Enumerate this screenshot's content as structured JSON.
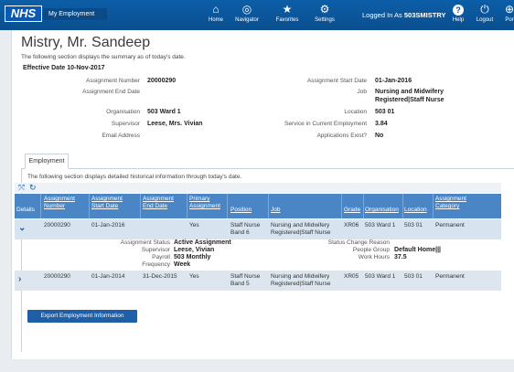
{
  "header": {
    "logo_text": "NHS",
    "app_name": "My Employment",
    "nav": [
      {
        "label": "Home",
        "icon": "home-icon",
        "glyph": "⌂"
      },
      {
        "label": "Navigator",
        "icon": "compass-icon",
        "glyph": "◎"
      },
      {
        "label": "Favorites",
        "icon": "star-icon",
        "glyph": "★"
      },
      {
        "label": "Settings",
        "icon": "gear-icon",
        "glyph": "⚙"
      }
    ],
    "logged_in_prefix": "Logged In As",
    "logged_in_user": "503SMISTRY",
    "right_nav": [
      {
        "label": "Help",
        "icon": "help-icon",
        "glyph": "?"
      },
      {
        "label": "Logout",
        "icon": "power-icon",
        "glyph": "⏻"
      },
      {
        "label": "Por",
        "icon": "globe-icon",
        "glyph": "⊕"
      }
    ]
  },
  "page": {
    "title": "Mistry, Mr. Sandeep",
    "subtitle": "The following section displays the summary as of today's date.",
    "effective_date": "Effective Date 10-Nov-2017"
  },
  "summary": {
    "left": [
      {
        "label": "Assignment Number",
        "value": "20000290"
      },
      {
        "label": "Assignment End Date",
        "value": ""
      },
      {
        "label": "Organisation",
        "value": "503 Ward 1"
      },
      {
        "label": "Supervisor",
        "value": "Leese, Mrs. Vivian"
      },
      {
        "label": "Email Address",
        "value": ""
      }
    ],
    "right": [
      {
        "label": "Assignment Start Date",
        "value": "01-Jan-2016"
      },
      {
        "label": "Job",
        "value": "Nursing and Midwifery",
        "value2": "Registered|Staff Nurse"
      },
      {
        "label": "Location",
        "value": "503 01"
      },
      {
        "label": "Service in Current Employment",
        "value": "3.84"
      },
      {
        "label": "Applications Exist?",
        "value": "No"
      }
    ]
  },
  "tabs": [
    {
      "label": "Employment"
    }
  ],
  "employment": {
    "description": "The following section displays detailed historical information through today's date.",
    "columns": [
      {
        "l1": "",
        "l2": "Details"
      },
      {
        "l1": "Assignment",
        "l2": "Number"
      },
      {
        "l1": "Assignment",
        "l2": "Start Date"
      },
      {
        "l1": "Assignment",
        "l2": "End Date"
      },
      {
        "l1": "Primary",
        "l2": "Assignment"
      },
      {
        "l1": "",
        "l2": "Position"
      },
      {
        "l1": "",
        "l2": "Job"
      },
      {
        "l1": "",
        "l2": "Grade"
      },
      {
        "l1": "",
        "l2": "Organisation"
      },
      {
        "l1": "",
        "l2": "Location"
      },
      {
        "l1": "Assignment",
        "l2": "Category"
      }
    ],
    "rows": [
      {
        "number": "20000290",
        "start": "01-Jan-2016",
        "end": "",
        "primary": "Yes",
        "position1": "Staff Nurse",
        "position2": "Band 6",
        "job1": "Nursing and Midwifery",
        "job2": "Registered|Staff Nurse",
        "grade": "XR06",
        "organisation": "503 Ward 1",
        "location": "503 01",
        "category": "Permanent"
      },
      {
        "number": "20000290",
        "start": "01-Jan-2014",
        "end": "31-Dec-2015",
        "primary": "Yes",
        "position1": "Staff Nurse",
        "position2": "Band 5",
        "job1": "Nursing and Midwifery",
        "job2": "Registered|Staff Nurse",
        "grade": "XR05",
        "organisation": "503 Ward 1",
        "location": "503 01",
        "category": "Permanent"
      }
    ],
    "detail": {
      "left": [
        {
          "label": "Assignment Status",
          "value": "Active Assignment"
        },
        {
          "label": "Supervisor",
          "value": "Leese, Vivian"
        },
        {
          "label": "Payroll",
          "value": "503 Monthly"
        },
        {
          "label": "Frequency",
          "value": "Week"
        }
      ],
      "right": [
        {
          "label": "Status Change Reason",
          "value": ""
        },
        {
          "label": "People Group",
          "value": "Default Home|||"
        },
        {
          "label": "Work Hours",
          "value": "37.5"
        }
      ]
    },
    "export_label": "Export Employment Information"
  },
  "colors": {
    "topbar": "#0b5394",
    "accent": "#1f5fa8",
    "table_header": "#4a86c5"
  }
}
